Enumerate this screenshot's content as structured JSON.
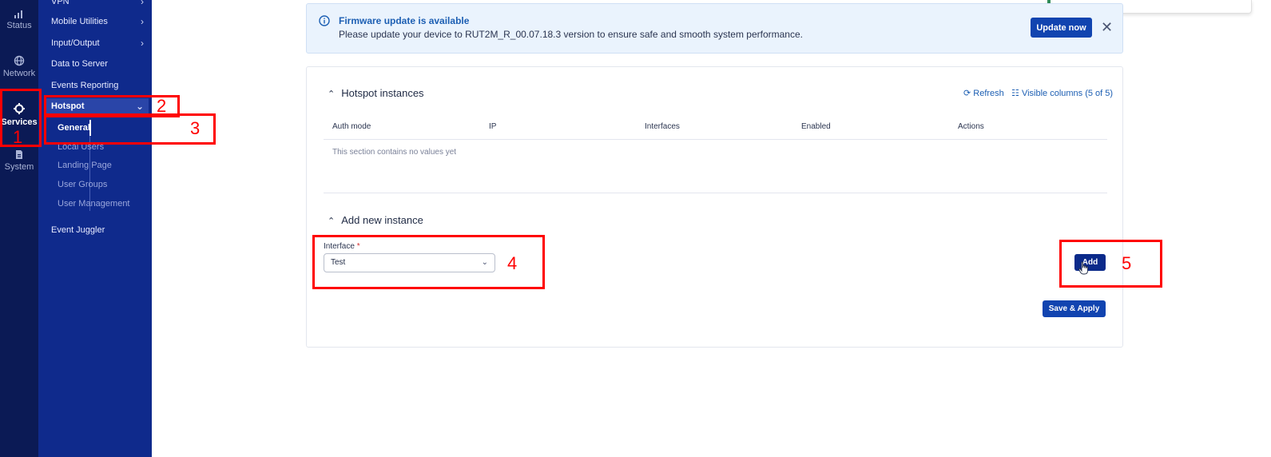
{
  "rail": {
    "items": [
      {
        "label": "Status",
        "icon": "signal-icon"
      },
      {
        "label": "Network",
        "icon": "globe-icon"
      },
      {
        "label": "Services",
        "icon": "gear-icon",
        "active": true
      },
      {
        "label": "System",
        "icon": "file-icon"
      }
    ]
  },
  "submenu": {
    "vpn": "VPN",
    "mobile_utilities": "Mobile Utilities",
    "input_output": "Input/Output",
    "data_to_server": "Data to Server",
    "events_reporting": "Events Reporting",
    "hotspot": "Hotspot",
    "hotspot_items": [
      "General",
      "Local Users",
      "Landing Page",
      "User Groups",
      "User Management"
    ],
    "event_juggler": "Event Juggler"
  },
  "annotations": [
    "1",
    "2",
    "3",
    "4",
    "5"
  ],
  "banner": {
    "title": "Firmware update is available",
    "text": "Please update your device to RUT2M_R_00.07.18.3 version to ensure safe and smooth system performance.",
    "update_button": "Update now",
    "close": "✕"
  },
  "hotspot_instances": {
    "title": "Hotspot instances",
    "refresh": "Refresh",
    "visible_columns": "Visible columns (5 of 5)",
    "columns": [
      "Auth mode",
      "IP",
      "Interfaces",
      "Enabled",
      "Actions"
    ],
    "empty_text": "This section contains no values yet"
  },
  "add_instance": {
    "title": "Add new instance",
    "interface_label": "Interface",
    "required_mark": "*",
    "interface_value": "Test",
    "add_button": "Add",
    "save_button": "Save & Apply"
  },
  "colors": {
    "rail_bg": "#0b1a55",
    "submenu_bg": "#0f2a8c",
    "accent": "#1144b0",
    "annotation": "#ff0000"
  }
}
